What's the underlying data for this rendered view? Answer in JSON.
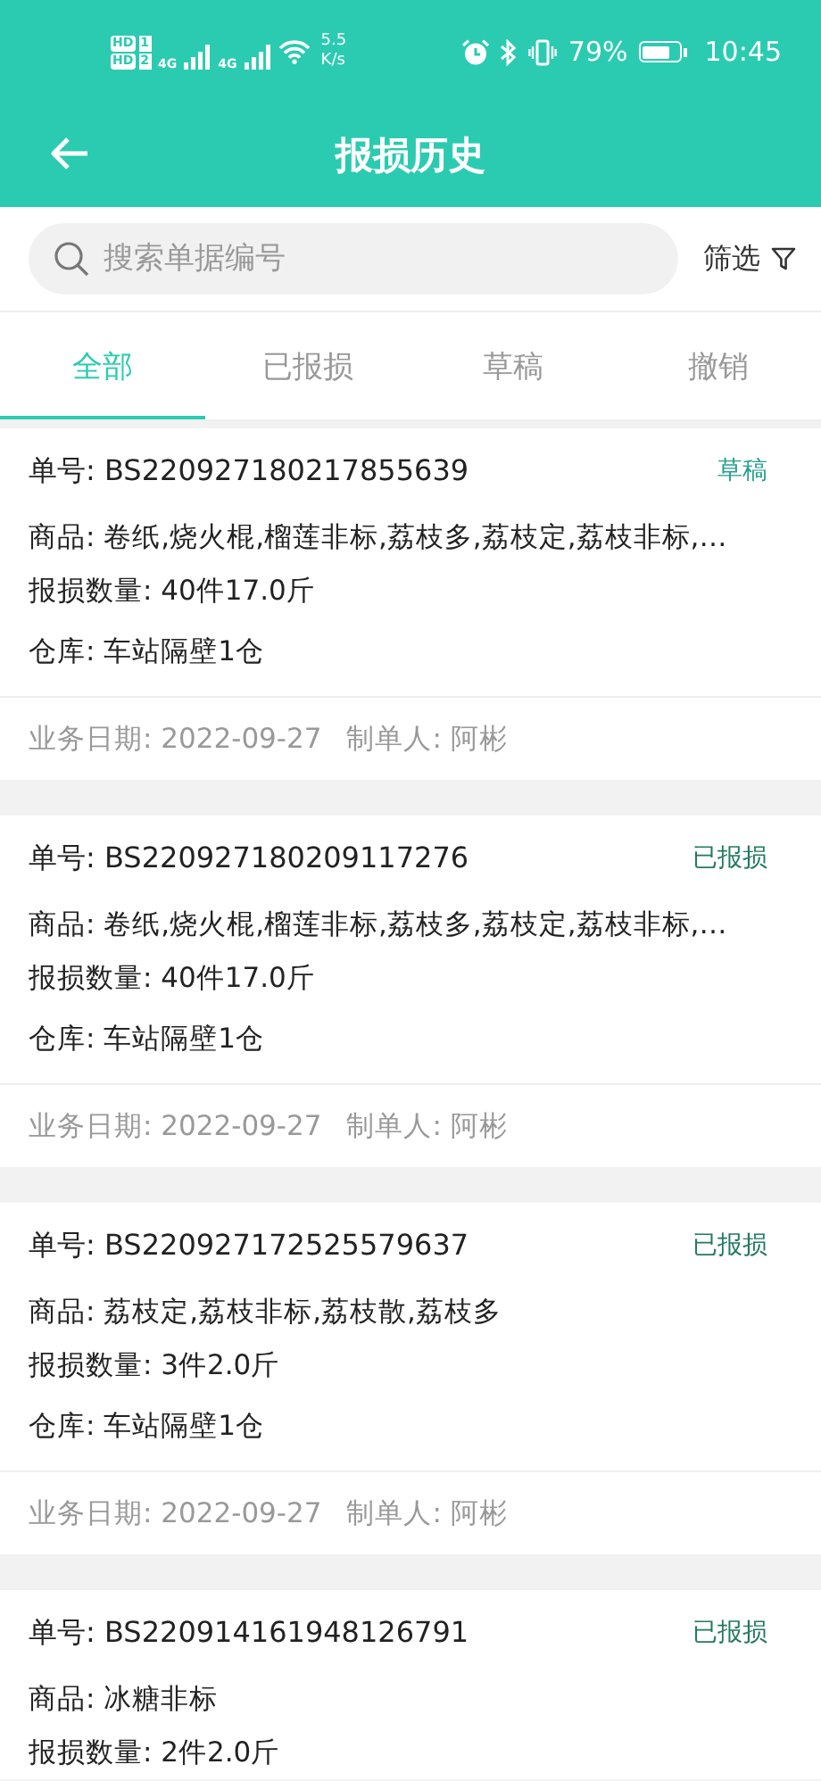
{
  "status_bar": {
    "sim_labels": [
      "HD",
      "HD"
    ],
    "sim_numbers": [
      "1",
      "2"
    ],
    "networks": [
      "4G",
      "4G"
    ],
    "speed": "5.5",
    "speed_unit": "K/s",
    "battery": "79%",
    "time": "10:45"
  },
  "header": {
    "title": "报损历史"
  },
  "search": {
    "placeholder": "搜索单据编号",
    "filter": "筛选"
  },
  "tabs": [
    {
      "label": "全部",
      "selected": true
    },
    {
      "label": "已报损",
      "selected": false
    },
    {
      "label": "草稿",
      "selected": false
    },
    {
      "label": "撤销",
      "selected": false
    }
  ],
  "records": [
    {
      "number": "单号: BS220927180217855639",
      "status": "草稿",
      "color": "#26a08c",
      "goods": "商品: 卷纸,烧火棍,榴莲非标,荔枝多,荔枝定,荔枝非标,…",
      "quantity": "报损数量: 40件17.0斤",
      "warehouse": "仓库: 车站隔壁1仓",
      "date": "业务日期: 2022-09-27",
      "maker": "制单人: 阿彬"
    },
    {
      "number": "单号: BS220927180209117276",
      "status": "已报损",
      "color": "#237a5c",
      "goods": "商品: 卷纸,烧火棍,榴莲非标,荔枝多,荔枝定,荔枝非标,…",
      "quantity": "报损数量: 40件17.0斤",
      "warehouse": "仓库: 车站隔壁1仓",
      "date": "业务日期: 2022-09-27",
      "maker": "制单人: 阿彬"
    },
    {
      "number": "单号: BS220927172525579637",
      "status": "已报损",
      "color": "#237a5c",
      "goods": "商品: 荔枝定,荔枝非标,荔枝散,荔枝多",
      "quantity": "报损数量: 3件2.0斤",
      "warehouse": "仓库: 车站隔壁1仓",
      "date": "业务日期: 2022-09-27",
      "maker": "制单人: 阿彬"
    },
    {
      "number": "单号: BS220914161948126791",
      "status": "已报损",
      "color": "#237a5c",
      "goods": "商品: 冰糖非标",
      "quantity": "报损数量: 2件2.0斤"
    }
  ]
}
